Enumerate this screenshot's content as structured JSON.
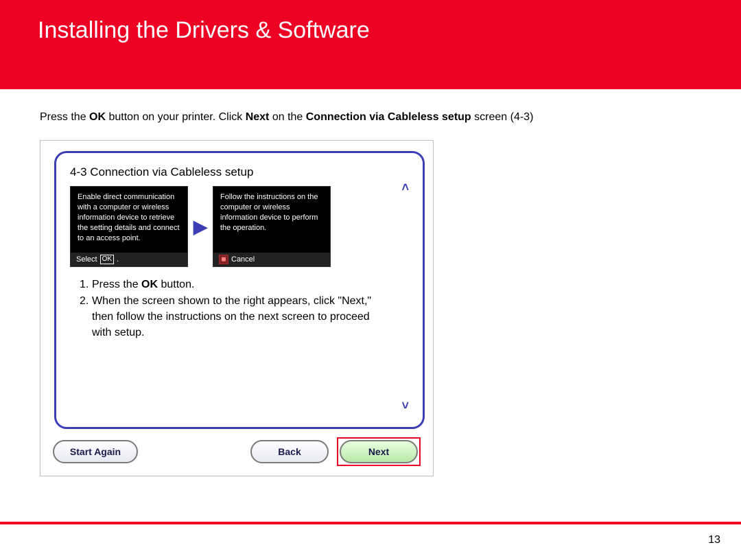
{
  "header": {
    "title": "Installing  the Drivers & Software"
  },
  "instruction": {
    "p1": "Press the  ",
    "b1": "OK",
    "p2": " button on your printer.  Click ",
    "b2": "Next",
    "p3": " on the ",
    "b3": "Connection via Cableless setup",
    "p4": " screen (4-3)"
  },
  "dialog": {
    "title": "4-3 Connection via Cableless setup",
    "screen1": {
      "body": "Enable direct communication with a computer or wireless information device to retrieve the setting details and connect to an access point.",
      "select_label": "Select",
      "ok_label": "OK"
    },
    "screen2": {
      "body": "Follow the instructions on the computer or wireless information device to perform the operation.",
      "cancel_label": "Cancel"
    },
    "list": {
      "n1": "1.",
      "l1a": "Press the ",
      "l1b": "OK",
      "l1c": " button.",
      "n2": "2.",
      "l2": "When the screen shown to the right appears, click \"Next,\" then follow the instructions on the next screen to proceed with setup."
    },
    "buttons": {
      "start_again": "Start Again",
      "back": "Back",
      "next": "Next"
    }
  },
  "page_number": "13"
}
